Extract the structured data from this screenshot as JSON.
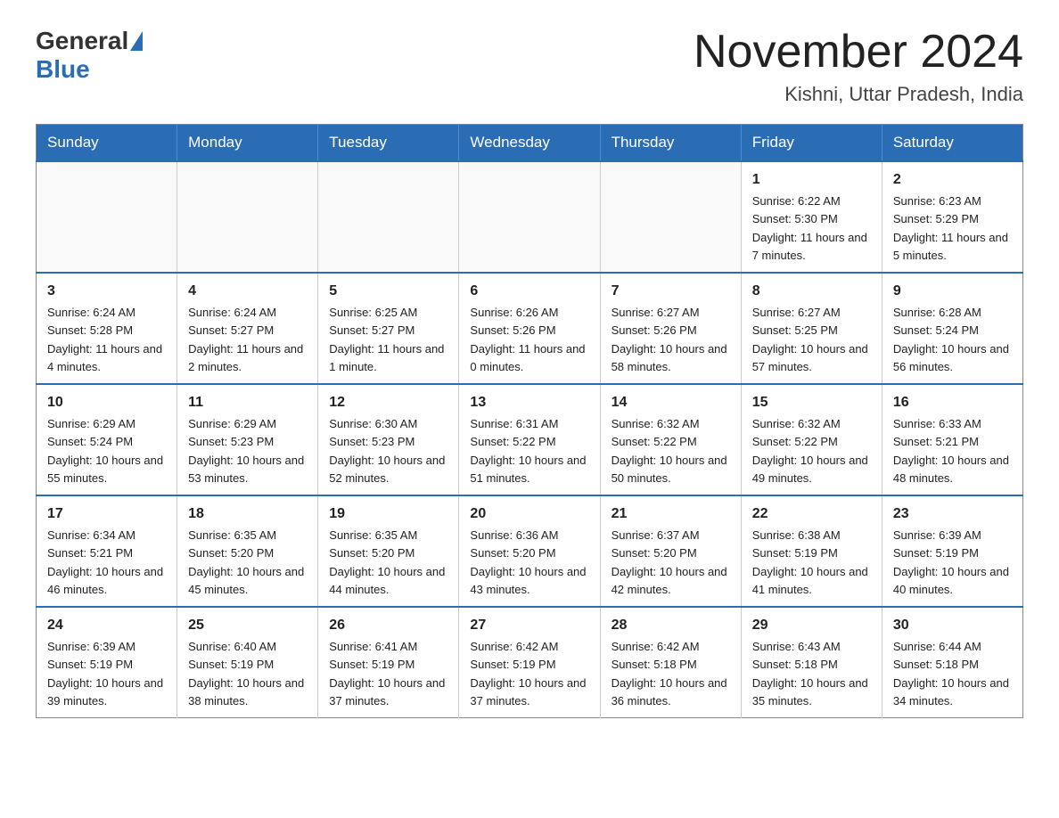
{
  "header": {
    "logo": {
      "general": "General",
      "blue": "Blue"
    },
    "title": "November 2024",
    "location": "Kishni, Uttar Pradesh, India"
  },
  "days_of_week": [
    "Sunday",
    "Monday",
    "Tuesday",
    "Wednesday",
    "Thursday",
    "Friday",
    "Saturday"
  ],
  "weeks": [
    [
      {
        "day": "",
        "info": ""
      },
      {
        "day": "",
        "info": ""
      },
      {
        "day": "",
        "info": ""
      },
      {
        "day": "",
        "info": ""
      },
      {
        "day": "",
        "info": ""
      },
      {
        "day": "1",
        "info": "Sunrise: 6:22 AM\nSunset: 5:30 PM\nDaylight: 11 hours and 7 minutes."
      },
      {
        "day": "2",
        "info": "Sunrise: 6:23 AM\nSunset: 5:29 PM\nDaylight: 11 hours and 5 minutes."
      }
    ],
    [
      {
        "day": "3",
        "info": "Sunrise: 6:24 AM\nSunset: 5:28 PM\nDaylight: 11 hours and 4 minutes."
      },
      {
        "day": "4",
        "info": "Sunrise: 6:24 AM\nSunset: 5:27 PM\nDaylight: 11 hours and 2 minutes."
      },
      {
        "day": "5",
        "info": "Sunrise: 6:25 AM\nSunset: 5:27 PM\nDaylight: 11 hours and 1 minute."
      },
      {
        "day": "6",
        "info": "Sunrise: 6:26 AM\nSunset: 5:26 PM\nDaylight: 11 hours and 0 minutes."
      },
      {
        "day": "7",
        "info": "Sunrise: 6:27 AM\nSunset: 5:26 PM\nDaylight: 10 hours and 58 minutes."
      },
      {
        "day": "8",
        "info": "Sunrise: 6:27 AM\nSunset: 5:25 PM\nDaylight: 10 hours and 57 minutes."
      },
      {
        "day": "9",
        "info": "Sunrise: 6:28 AM\nSunset: 5:24 PM\nDaylight: 10 hours and 56 minutes."
      }
    ],
    [
      {
        "day": "10",
        "info": "Sunrise: 6:29 AM\nSunset: 5:24 PM\nDaylight: 10 hours and 55 minutes."
      },
      {
        "day": "11",
        "info": "Sunrise: 6:29 AM\nSunset: 5:23 PM\nDaylight: 10 hours and 53 minutes."
      },
      {
        "day": "12",
        "info": "Sunrise: 6:30 AM\nSunset: 5:23 PM\nDaylight: 10 hours and 52 minutes."
      },
      {
        "day": "13",
        "info": "Sunrise: 6:31 AM\nSunset: 5:22 PM\nDaylight: 10 hours and 51 minutes."
      },
      {
        "day": "14",
        "info": "Sunrise: 6:32 AM\nSunset: 5:22 PM\nDaylight: 10 hours and 50 minutes."
      },
      {
        "day": "15",
        "info": "Sunrise: 6:32 AM\nSunset: 5:22 PM\nDaylight: 10 hours and 49 minutes."
      },
      {
        "day": "16",
        "info": "Sunrise: 6:33 AM\nSunset: 5:21 PM\nDaylight: 10 hours and 48 minutes."
      }
    ],
    [
      {
        "day": "17",
        "info": "Sunrise: 6:34 AM\nSunset: 5:21 PM\nDaylight: 10 hours and 46 minutes."
      },
      {
        "day": "18",
        "info": "Sunrise: 6:35 AM\nSunset: 5:20 PM\nDaylight: 10 hours and 45 minutes."
      },
      {
        "day": "19",
        "info": "Sunrise: 6:35 AM\nSunset: 5:20 PM\nDaylight: 10 hours and 44 minutes."
      },
      {
        "day": "20",
        "info": "Sunrise: 6:36 AM\nSunset: 5:20 PM\nDaylight: 10 hours and 43 minutes."
      },
      {
        "day": "21",
        "info": "Sunrise: 6:37 AM\nSunset: 5:20 PM\nDaylight: 10 hours and 42 minutes."
      },
      {
        "day": "22",
        "info": "Sunrise: 6:38 AM\nSunset: 5:19 PM\nDaylight: 10 hours and 41 minutes."
      },
      {
        "day": "23",
        "info": "Sunrise: 6:39 AM\nSunset: 5:19 PM\nDaylight: 10 hours and 40 minutes."
      }
    ],
    [
      {
        "day": "24",
        "info": "Sunrise: 6:39 AM\nSunset: 5:19 PM\nDaylight: 10 hours and 39 minutes."
      },
      {
        "day": "25",
        "info": "Sunrise: 6:40 AM\nSunset: 5:19 PM\nDaylight: 10 hours and 38 minutes."
      },
      {
        "day": "26",
        "info": "Sunrise: 6:41 AM\nSunset: 5:19 PM\nDaylight: 10 hours and 37 minutes."
      },
      {
        "day": "27",
        "info": "Sunrise: 6:42 AM\nSunset: 5:19 PM\nDaylight: 10 hours and 37 minutes."
      },
      {
        "day": "28",
        "info": "Sunrise: 6:42 AM\nSunset: 5:18 PM\nDaylight: 10 hours and 36 minutes."
      },
      {
        "day": "29",
        "info": "Sunrise: 6:43 AM\nSunset: 5:18 PM\nDaylight: 10 hours and 35 minutes."
      },
      {
        "day": "30",
        "info": "Sunrise: 6:44 AM\nSunset: 5:18 PM\nDaylight: 10 hours and 34 minutes."
      }
    ]
  ]
}
